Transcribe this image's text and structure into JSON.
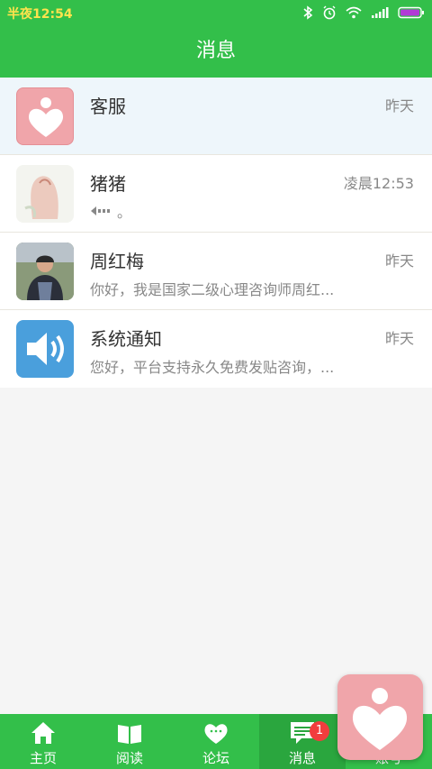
{
  "status": {
    "time": "半夜12:54"
  },
  "header": {
    "title": "消息"
  },
  "messages": [
    {
      "name": "客服",
      "time": "昨天",
      "preview": "",
      "avatar": "heart-logo-icon"
    },
    {
      "name": "猪猪",
      "time": "凌晨12:53",
      "preview": "。",
      "avatar": "sketch-avatar"
    },
    {
      "name": "周红梅",
      "time": "昨天",
      "preview": "你好，我是国家二级心理咨询师周红...",
      "avatar": "photo-avatar"
    },
    {
      "name": "系统通知",
      "time": "昨天",
      "preview": "您好，平台支持永久免费发贴咨询，...",
      "avatar": "speaker-icon"
    }
  ],
  "tabs": [
    {
      "label": "主页",
      "icon": "home-icon"
    },
    {
      "label": "阅读",
      "icon": "book-icon"
    },
    {
      "label": "论坛",
      "icon": "forum-heart-icon"
    },
    {
      "label": "消息",
      "icon": "message-icon",
      "badge": "1"
    },
    {
      "label": "账号",
      "icon": "account-icon"
    }
  ],
  "colors": {
    "brand_green": "#33bf4a",
    "active_tab": "#2aa63e",
    "badge_red": "#f23d3d",
    "logo_pink": "#f0a5aa"
  }
}
